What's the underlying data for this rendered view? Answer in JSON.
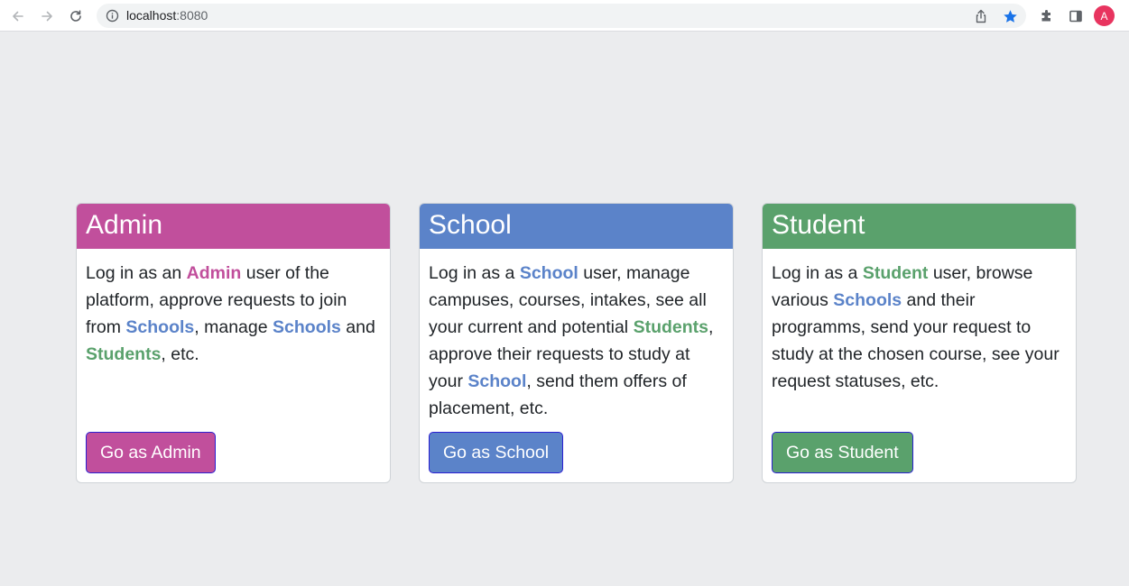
{
  "browser": {
    "url_host": "localhost",
    "url_port": ":8080",
    "avatar_letter": "A",
    "star_color": "#1a73e8"
  },
  "colors": {
    "admin": "#c14f9c",
    "school": "#5b83c9",
    "student": "#5aa16c"
  },
  "cards": {
    "admin": {
      "title": "Admin",
      "p1": "Log in as an ",
      "k1": "Admin",
      "p2": " user of the platform, approve requests to join from ",
      "k2": "Schools",
      "p3": ", manage ",
      "k3": "Schools",
      "p4": " and ",
      "k4": "Students",
      "p5": ", etc.",
      "button": "Go as Admin"
    },
    "school": {
      "title": "School",
      "p1": "Log in as a ",
      "k1": "School",
      "p2": " user, manage campuses, courses, intakes, see all your current and potential ",
      "k2": "Students",
      "p3": ", approve their requests to study at your ",
      "k3": "School",
      "p4": ", send them offers of placement, etc.",
      "button": "Go as School"
    },
    "student": {
      "title": "Student",
      "p1": "Log in as a ",
      "k1": "Student",
      "p2": " user, browse various ",
      "k2": "Schools",
      "p3": " and their programms, send your request to study at the chosen course, see your request statuses, etc.",
      "button": "Go as Student"
    }
  }
}
